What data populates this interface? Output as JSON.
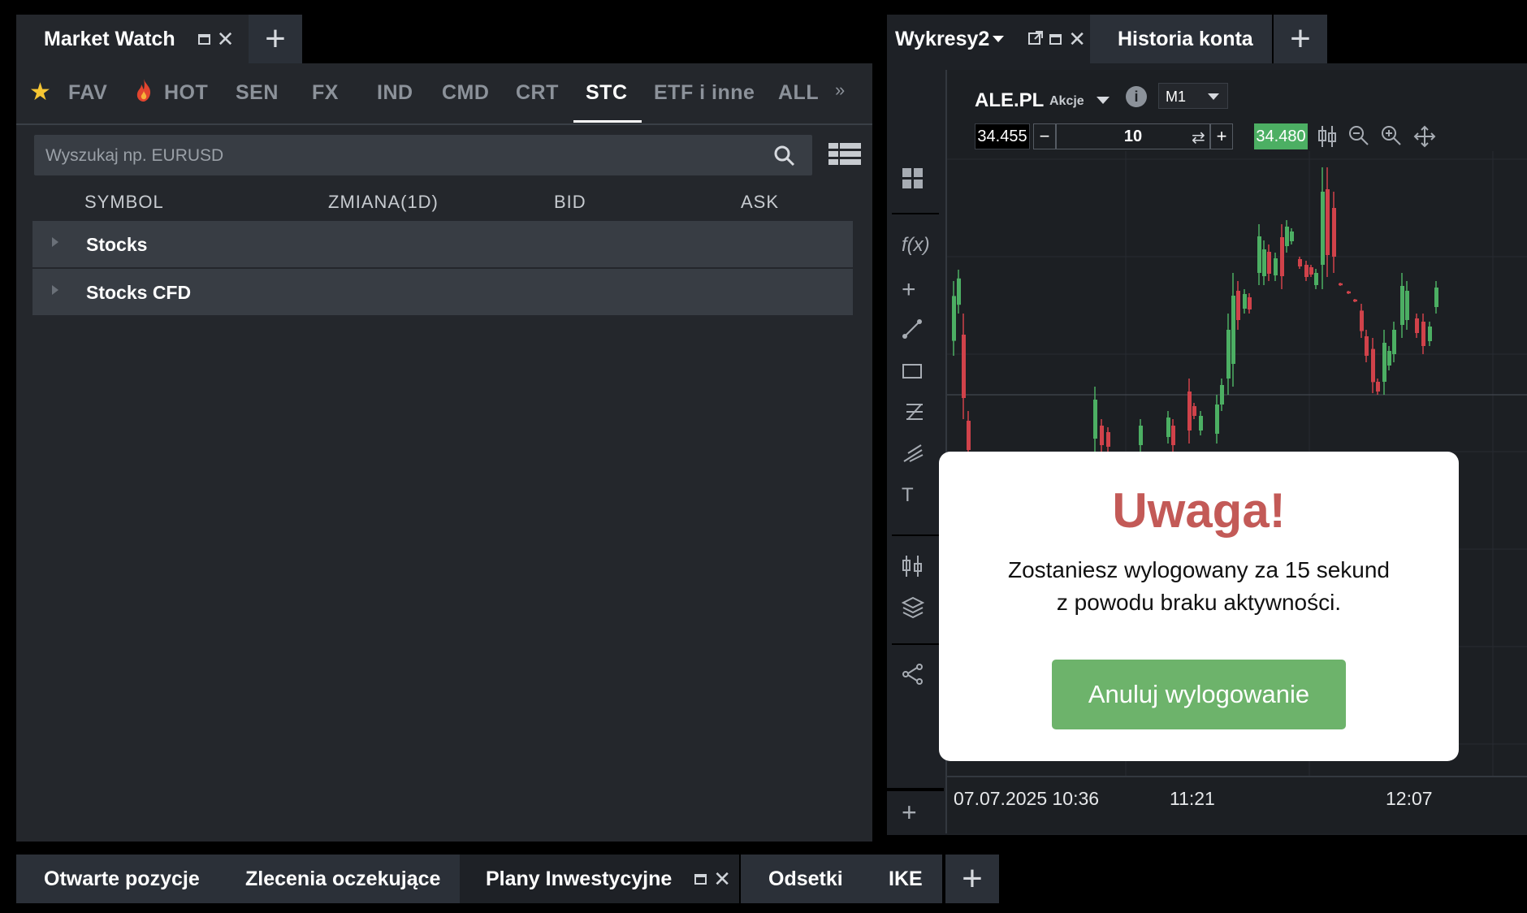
{
  "left_panel": {
    "tab_title": "Market Watch",
    "categories": [
      "FAV",
      "HOT",
      "SEN",
      "FX",
      "IND",
      "CMD",
      "CRT",
      "STC",
      "ETF i inne",
      "ALL"
    ],
    "active_category": "STC",
    "search_placeholder": "Wyszukaj np. EURUSD",
    "columns": [
      "SYMBOL",
      "ZMIANA(1D)",
      "BID",
      "ASK"
    ],
    "groups": [
      "Stocks",
      "Stocks CFD"
    ]
  },
  "right_tabs": {
    "chart_tab": "Wykresy2",
    "history_tab": "Historia konta"
  },
  "chart": {
    "symbol": "ALE.PL",
    "instrument_type": "Akcje",
    "timeframe": "M1",
    "bid": "34.455",
    "volume": "10",
    "ask": "34.480",
    "x_labels": [
      "07.07.2025 10:36",
      "11:21",
      "12:07"
    ]
  },
  "modal": {
    "title": "Uwaga!",
    "line1": "Zostaniesz wylogowany za 15 sekund",
    "line2": "z powodu braku aktywności.",
    "button": "Anuluj wylogowanie"
  },
  "bottom_tabs": [
    "Otwarte pozycje",
    "Zlecenia oczekujące",
    "Plany Inwestycyjne",
    "Odsetki",
    "IKE"
  ],
  "colors": {
    "accent_green": "#6db36b",
    "warning_red": "#c35a57",
    "candle_up": "#4caf63",
    "candle_down": "#d0424a"
  }
}
